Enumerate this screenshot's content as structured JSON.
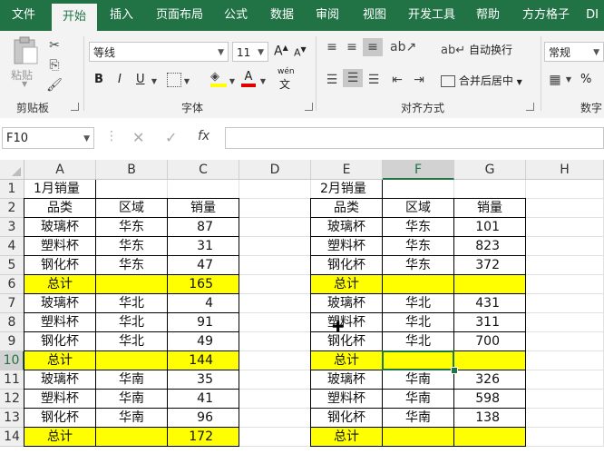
{
  "ribbon_tabs": [
    "文件",
    "开始",
    "插入",
    "页面布局",
    "公式",
    "数据",
    "审阅",
    "视图",
    "开发工具",
    "帮助",
    "方方格子",
    "DI"
  ],
  "active_tab": "开始",
  "clipboard": {
    "paste_label": "粘贴",
    "group_label": "剪贴板"
  },
  "font": {
    "name": "等线",
    "size": "11",
    "group_label": "字体",
    "bold": "B",
    "italic": "I",
    "underline": "U",
    "grow": "A",
    "shrink": "A",
    "font_color_letter": "A",
    "phonetic": "wén"
  },
  "alignment": {
    "wrap_label": "自动换行",
    "merge_label": "合并后居中",
    "group_label": "对齐方式"
  },
  "number": {
    "format": "常规",
    "group_label": "数字",
    "percent": "%"
  },
  "formula_bar": {
    "name_box": "F10",
    "fx": "fx",
    "content": ""
  },
  "columns": [
    "A",
    "B",
    "C",
    "D",
    "E",
    "F",
    "G",
    "H"
  ],
  "rows": [
    "1",
    "2",
    "3",
    "4",
    "5",
    "6",
    "7",
    "8",
    "9",
    "10",
    "11",
    "12",
    "13",
    "14"
  ],
  "selected_cell": {
    "col": "F",
    "row": "10"
  },
  "left_table": {
    "title": "1月销量",
    "headers": [
      "品类",
      "区域",
      "销量"
    ],
    "rows": [
      [
        "玻璃杯",
        "华东",
        "87"
      ],
      [
        "塑料杯",
        "华东",
        "31"
      ],
      [
        "钢化杯",
        "华东",
        "47"
      ],
      [
        "总计",
        "",
        "165"
      ],
      [
        "玻璃杯",
        "华北",
        "4"
      ],
      [
        "塑料杯",
        "华北",
        "91"
      ],
      [
        "钢化杯",
        "华北",
        "49"
      ],
      [
        "总计",
        "",
        "144"
      ],
      [
        "玻璃杯",
        "华南",
        "35"
      ],
      [
        "塑料杯",
        "华南",
        "41"
      ],
      [
        "钢化杯",
        "华南",
        "96"
      ],
      [
        "总计",
        "",
        "172"
      ]
    ]
  },
  "right_table": {
    "title": "2月销量",
    "headers": [
      "品类",
      "区域",
      "销量"
    ],
    "rows": [
      [
        "玻璃杯",
        "华东",
        "101"
      ],
      [
        "塑料杯",
        "华东",
        "823"
      ],
      [
        "钢化杯",
        "华东",
        "372"
      ],
      [
        "总计",
        "",
        ""
      ],
      [
        "玻璃杯",
        "华北",
        "431"
      ],
      [
        "塑料杯",
        "华北",
        "311"
      ],
      [
        "钢化杯",
        "华北",
        "700"
      ],
      [
        "总计",
        "",
        ""
      ],
      [
        "玻璃杯",
        "华南",
        "326"
      ],
      [
        "塑料杯",
        "华南",
        "598"
      ],
      [
        "钢化杯",
        "华南",
        "138"
      ],
      [
        "总计",
        "",
        ""
      ]
    ]
  },
  "colors": {
    "excel_green": "#217346",
    "total_fill": "#ffff00"
  }
}
